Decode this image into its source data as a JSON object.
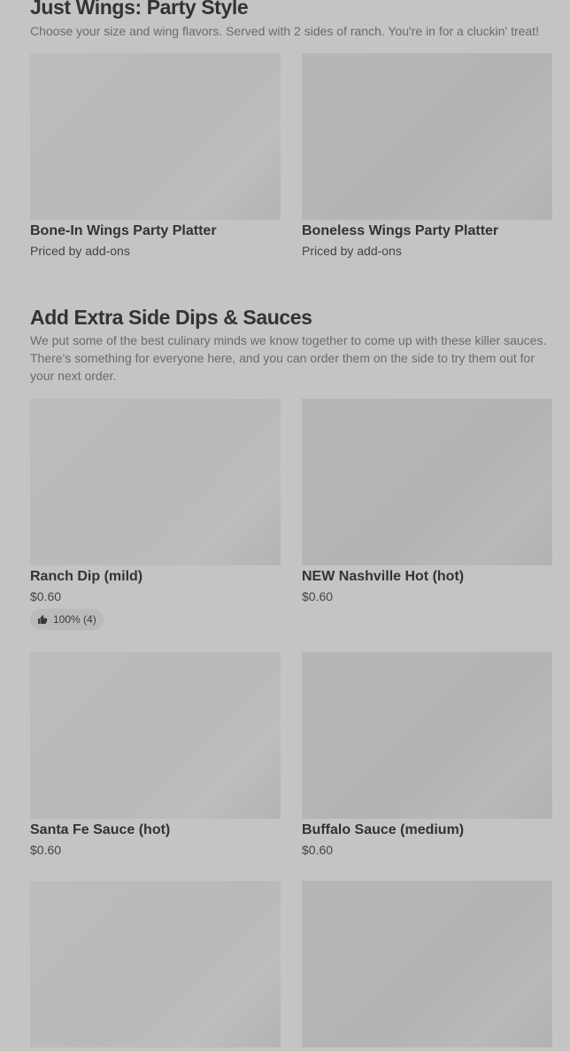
{
  "sections": [
    {
      "title": "Just Wings: Party Style",
      "description": "Choose your size and wing flavors. Served with 2 sides of ranch. You're in for a cluckin' treat!",
      "items": [
        {
          "name": "Bone-In Wings Party Platter",
          "price": "Priced by add-ons"
        },
        {
          "name": "Boneless Wings Party Platter",
          "price": "Priced by add-ons"
        }
      ]
    },
    {
      "title": "Add Extra Side Dips & Sauces",
      "description": "We put some of the best culinary minds we know together to come up with these killer sauces. There's something for everyone here, and you can order them on the side to try them out for your next order.",
      "items": [
        {
          "name": "Ranch Dip (mild)",
          "price": "$0.60",
          "rating": "100% (4)",
          "rating_icon": "thumbs-up-icon"
        },
        {
          "name": "NEW Nashville Hot (hot)",
          "price": "$0.60"
        },
        {
          "name": "Santa Fe Sauce (hot)",
          "price": "$0.60"
        },
        {
          "name": "Buffalo Sauce (medium)",
          "price": "$0.60"
        }
      ]
    }
  ],
  "colors": {
    "overlay_background": "#c4c4c4",
    "text_primary": "#333333",
    "text_secondary": "#6b6b6b"
  }
}
